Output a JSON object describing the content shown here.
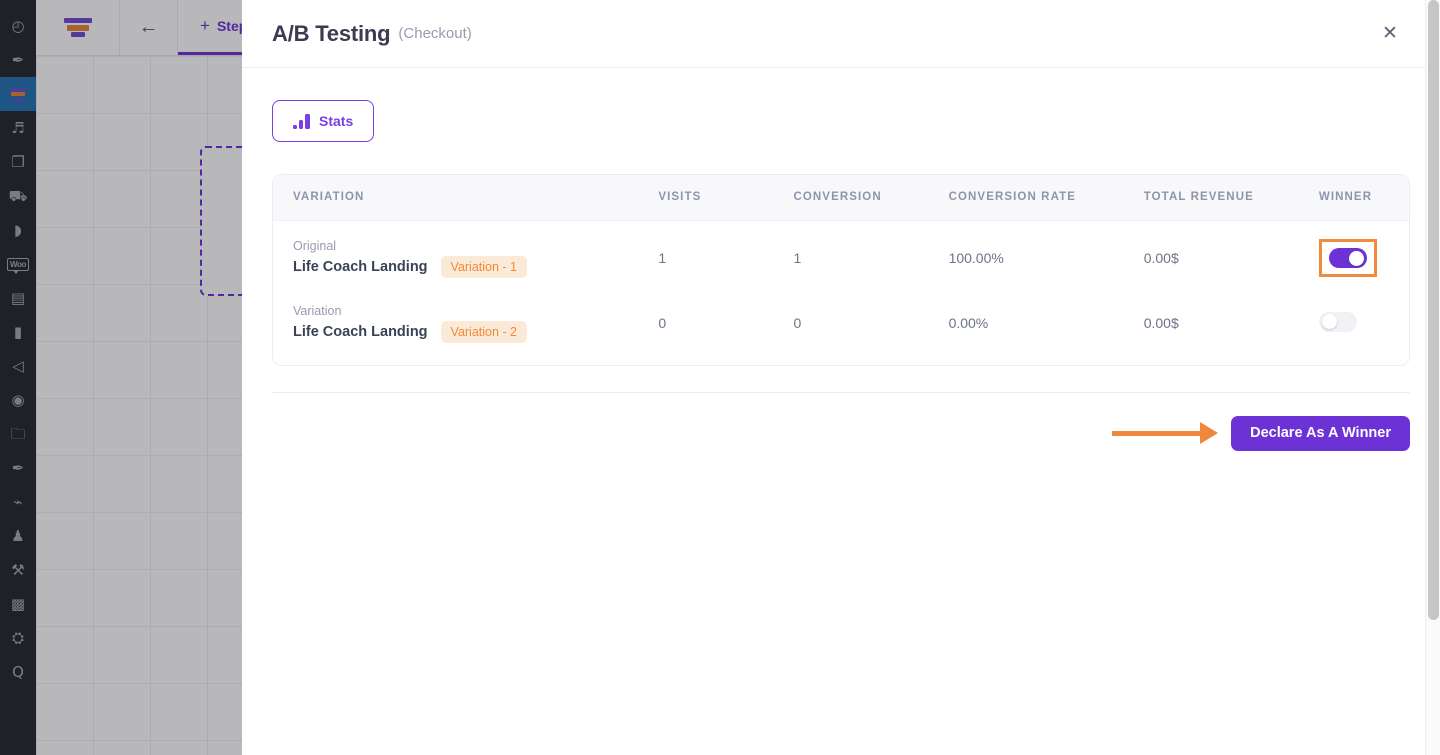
{
  "wp_sidebar": {
    "items": [
      {
        "name": "dashboard",
        "icon": "gauge-icon",
        "glyph": "◴",
        "active": false
      },
      {
        "name": "pin",
        "icon": "pin-icon",
        "glyph": "📌",
        "active": false
      },
      {
        "name": "funnels",
        "icon": "funnel-icon",
        "glyph": "",
        "active": true
      },
      {
        "name": "media",
        "icon": "media-icon",
        "glyph": "♫",
        "active": false
      },
      {
        "name": "pages",
        "icon": "pages-icon",
        "glyph": "❐",
        "active": false
      },
      {
        "name": "products",
        "icon": "cart-icon",
        "glyph": "🛒",
        "active": false
      },
      {
        "name": "comments",
        "icon": "comment-icon",
        "glyph": "💬",
        "active": false
      },
      {
        "name": "woocommerce",
        "icon": "woo-icon",
        "glyph": "Woo",
        "active": false
      },
      {
        "name": "archive",
        "icon": "archive-icon",
        "glyph": "🗃",
        "active": false
      },
      {
        "name": "analytics",
        "icon": "bar-chart-icon",
        "glyph": "📊",
        "active": false
      },
      {
        "name": "marketing",
        "icon": "megaphone-icon",
        "glyph": "📣",
        "active": false
      },
      {
        "name": "elementor",
        "icon": "elementor-icon",
        "glyph": "🅴",
        "active": false
      },
      {
        "name": "templates",
        "icon": "folder-icon",
        "glyph": "🗀",
        "active": false
      },
      {
        "name": "pinned",
        "icon": "pushpin-icon",
        "glyph": "📌",
        "active": false
      },
      {
        "name": "plugins",
        "icon": "plug-icon",
        "glyph": "🔌",
        "active": false
      },
      {
        "name": "users",
        "icon": "user-icon",
        "glyph": "👤",
        "active": false
      },
      {
        "name": "tools",
        "icon": "wrench-icon",
        "glyph": "🔧",
        "active": false
      },
      {
        "name": "integrations",
        "icon": "box-icon",
        "glyph": "🏣",
        "active": false
      },
      {
        "name": "settings",
        "icon": "gear-slash-icon",
        "glyph": "⛭",
        "active": false
      },
      {
        "name": "quick",
        "icon": "q-icon",
        "glyph": "Q",
        "active": false
      }
    ]
  },
  "builder": {
    "logo_name": "funnel-logo",
    "back_label": "←",
    "tab": {
      "plus": "+",
      "label": "Step"
    }
  },
  "modal": {
    "title": "A/B Testing",
    "subtitle": "(Checkout)",
    "close_label": "✕",
    "stats_button": "Stats",
    "table": {
      "headers": [
        "VARIATION",
        "VISITS",
        "CONVERSION",
        "CONVERSION RATE",
        "TOTAL REVENUE",
        "WINNER"
      ],
      "rows": [
        {
          "kind": "Original",
          "name": "Life Coach Landing",
          "badge": "Variation - 1",
          "visits": "1",
          "conversion": "1",
          "conversion_rate": "100.00%",
          "total_revenue": "0.00$",
          "winner_on": true,
          "highlighted": true
        },
        {
          "kind": "Variation",
          "name": "Life Coach Landing",
          "badge": "Variation - 2",
          "visits": "0",
          "conversion": "0",
          "conversion_rate": "0.00%",
          "total_revenue": "0.00$",
          "winner_on": false,
          "highlighted": false
        }
      ]
    },
    "declare_button": "Declare As A Winner"
  },
  "colors": {
    "accent_purple": "#6d32d6",
    "annotation_orange": "#f0883c",
    "badge_bg": "#fcead9",
    "badge_text": "#ef8b39"
  }
}
